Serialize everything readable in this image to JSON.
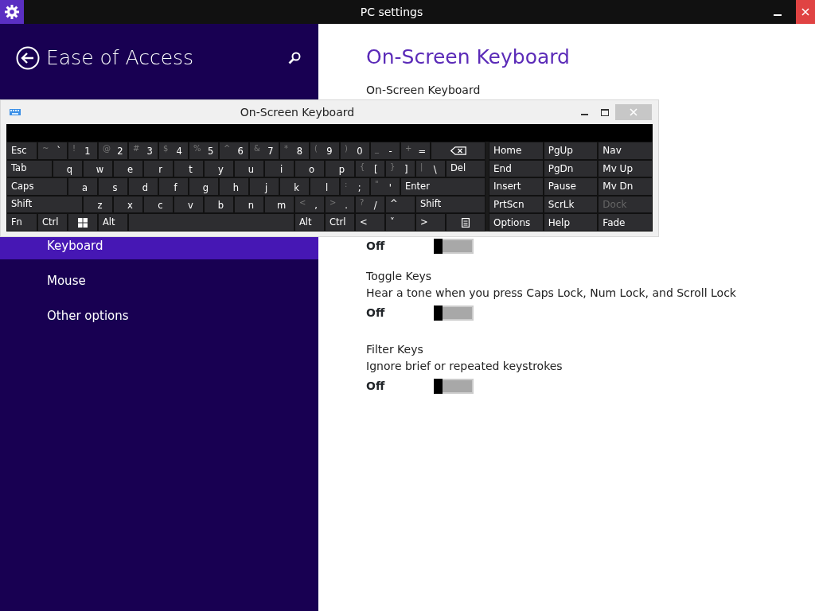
{
  "window": {
    "title": "PC settings"
  },
  "sidebar": {
    "title": "Ease of Access",
    "items": [
      {
        "label": "Keyboard",
        "selected": true
      },
      {
        "label": "Mouse",
        "selected": false
      },
      {
        "label": "Other options",
        "selected": false
      }
    ]
  },
  "content": {
    "heading": "On-Screen Keyboard",
    "settings": [
      {
        "title": "On-Screen Keyboard"
      },
      {
        "on": false,
        "state_label": "Off"
      },
      {
        "title": "Toggle Keys",
        "description": "Hear a tone when you press Caps Lock, Num Lock, and Scroll Lock",
        "on": false,
        "state_label": "Off"
      },
      {
        "title": "Filter Keys",
        "description": "Ignore brief or repeated keystrokes",
        "on": false,
        "state_label": "Off"
      }
    ]
  },
  "osk": {
    "title": "On-Screen Keyboard",
    "main_rows": [
      [
        {
          "kind": "text",
          "label": "Esc"
        },
        {
          "kind": "char",
          "shift": "~",
          "label": "`"
        },
        {
          "kind": "char",
          "shift": "!",
          "label": "1"
        },
        {
          "kind": "char",
          "shift": "@",
          "label": "2"
        },
        {
          "kind": "char",
          "shift": "#",
          "label": "3"
        },
        {
          "kind": "char",
          "shift": "$",
          "label": "4"
        },
        {
          "kind": "char",
          "shift": "%",
          "label": "5"
        },
        {
          "kind": "char",
          "shift": "^",
          "label": "6"
        },
        {
          "kind": "char",
          "shift": "&",
          "label": "7"
        },
        {
          "kind": "char",
          "shift": "*",
          "label": "8"
        },
        {
          "kind": "char",
          "shift": "(",
          "label": "9"
        },
        {
          "kind": "char",
          "shift": ")",
          "label": "0"
        },
        {
          "kind": "char",
          "shift": "_",
          "label": "-"
        },
        {
          "kind": "char",
          "shift": "+",
          "label": "="
        },
        {
          "kind": "backspace"
        }
      ],
      [
        {
          "kind": "text",
          "label": "Tab"
        },
        {
          "kind": "char",
          "label": "q"
        },
        {
          "kind": "char",
          "label": "w"
        },
        {
          "kind": "char",
          "label": "e"
        },
        {
          "kind": "char",
          "label": "r"
        },
        {
          "kind": "char",
          "label": "t"
        },
        {
          "kind": "char",
          "label": "y"
        },
        {
          "kind": "char",
          "label": "u"
        },
        {
          "kind": "char",
          "label": "i"
        },
        {
          "kind": "char",
          "label": "o"
        },
        {
          "kind": "char",
          "label": "p"
        },
        {
          "kind": "char",
          "shift": "{",
          "label": "["
        },
        {
          "kind": "char",
          "shift": "}",
          "label": "]"
        },
        {
          "kind": "char",
          "shift": "|",
          "label": "\\"
        },
        {
          "kind": "text",
          "label": "Del"
        }
      ],
      [
        {
          "kind": "text",
          "label": "Caps"
        },
        {
          "kind": "char",
          "label": "a"
        },
        {
          "kind": "char",
          "label": "s"
        },
        {
          "kind": "char",
          "label": "d"
        },
        {
          "kind": "char",
          "label": "f"
        },
        {
          "kind": "char",
          "label": "g"
        },
        {
          "kind": "char",
          "label": "h"
        },
        {
          "kind": "char",
          "label": "j"
        },
        {
          "kind": "char",
          "label": "k"
        },
        {
          "kind": "char",
          "label": "l"
        },
        {
          "kind": "char",
          "shift": ":",
          "label": ";"
        },
        {
          "kind": "char",
          "shift": "\"",
          "label": "'"
        },
        {
          "kind": "text",
          "label": "Enter"
        }
      ],
      [
        {
          "kind": "text",
          "label": "Shift"
        },
        {
          "kind": "char",
          "label": "z"
        },
        {
          "kind": "char",
          "label": "x"
        },
        {
          "kind": "char",
          "label": "c"
        },
        {
          "kind": "char",
          "label": "v"
        },
        {
          "kind": "char",
          "label": "b"
        },
        {
          "kind": "char",
          "label": "n"
        },
        {
          "kind": "char",
          "label": "m"
        },
        {
          "kind": "char",
          "shift": "<",
          "label": ","
        },
        {
          "kind": "char",
          "shift": ">",
          "label": "."
        },
        {
          "kind": "char",
          "shift": "?",
          "label": "/"
        },
        {
          "kind": "text",
          "label": "^"
        },
        {
          "kind": "text",
          "label": "Shift"
        }
      ],
      [
        {
          "kind": "text",
          "label": "Fn"
        },
        {
          "kind": "text",
          "label": "Ctrl"
        },
        {
          "kind": "windows"
        },
        {
          "kind": "text",
          "label": "Alt"
        },
        {
          "kind": "space"
        },
        {
          "kind": "text",
          "label": "Alt"
        },
        {
          "kind": "text",
          "label": "Ctrl"
        },
        {
          "kind": "text",
          "label": "<"
        },
        {
          "kind": "text",
          "label": "˅"
        },
        {
          "kind": "text",
          "label": ">"
        },
        {
          "kind": "menu"
        }
      ]
    ],
    "nav_rows": [
      [
        {
          "label": "Home",
          "disabled": false
        },
        {
          "label": "PgUp",
          "disabled": false
        },
        {
          "label": "Nav",
          "disabled": false
        }
      ],
      [
        {
          "label": "End",
          "disabled": false
        },
        {
          "label": "PgDn",
          "disabled": false
        },
        {
          "label": "Mv Up",
          "disabled": false
        }
      ],
      [
        {
          "label": "Insert",
          "disabled": false
        },
        {
          "label": "Pause",
          "disabled": false
        },
        {
          "label": "Mv Dn",
          "disabled": false
        }
      ],
      [
        {
          "label": "PrtScn",
          "disabled": false
        },
        {
          "label": "ScrLk",
          "disabled": false
        },
        {
          "label": "Dock",
          "disabled": true
        }
      ],
      [
        {
          "label": "Options",
          "disabled": false
        },
        {
          "label": "Help",
          "disabled": false
        },
        {
          "label": "Fade",
          "disabled": false
        }
      ]
    ]
  }
}
